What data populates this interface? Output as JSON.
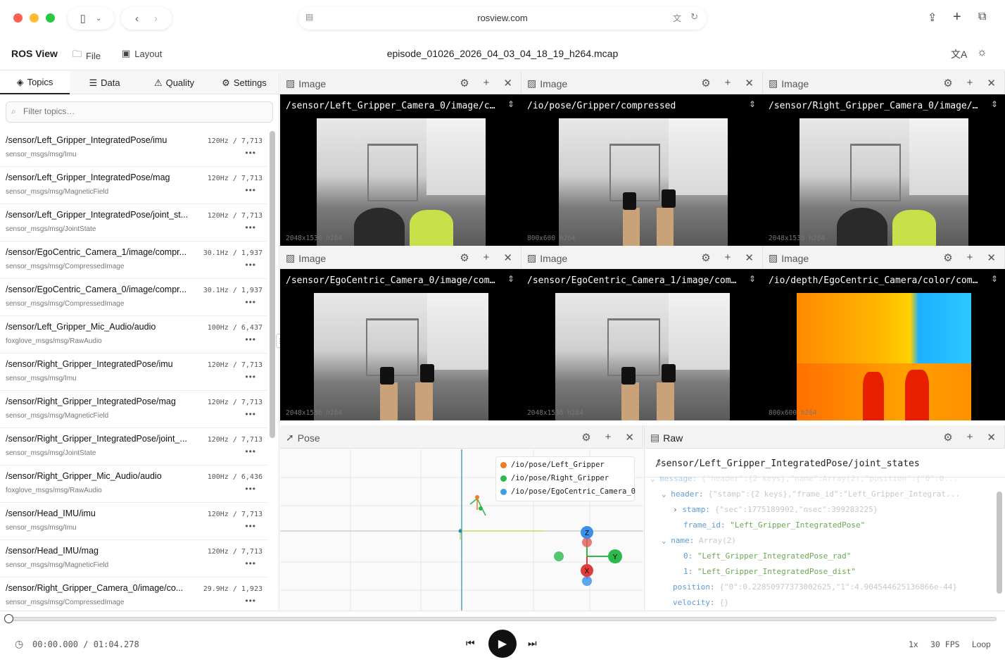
{
  "browser": {
    "url": "rosview.com"
  },
  "app": {
    "name": "ROS View",
    "menu_file": "File",
    "menu_layout": "Layout",
    "file_title": "episode_01026_2026_04_03_04_18_19_h264.mcap"
  },
  "sidebar": {
    "tabs": [
      "Topics",
      "Data",
      "Quality",
      "Settings"
    ],
    "filter_placeholder": "Filter topics…",
    "topics": [
      {
        "name": "/sensor/Left_Gripper_IntegratedPose/imu",
        "type": "sensor_msgs/msg/Imu",
        "rate": "120Hz / 7,713"
      },
      {
        "name": "/sensor/Left_Gripper_IntegratedPose/mag",
        "type": "sensor_msgs/msg/MagneticField",
        "rate": "120Hz / 7,713"
      },
      {
        "name": "/sensor/Left_Gripper_IntegratedPose/joint_st...",
        "type": "sensor_msgs/msg/JointState",
        "rate": "120Hz / 7,713"
      },
      {
        "name": "/sensor/EgoCentric_Camera_1/image/compr...",
        "type": "sensor_msgs/msg/CompressedImage",
        "rate": "30.1Hz / 1,937"
      },
      {
        "name": "/sensor/EgoCentric_Camera_0/image/compr...",
        "type": "sensor_msgs/msg/CompressedImage",
        "rate": "30.1Hz / 1,937"
      },
      {
        "name": "/sensor/Left_Gripper_Mic_Audio/audio",
        "type": "foxglove_msgs/msg/RawAudio",
        "rate": "100Hz / 6,437"
      },
      {
        "name": "/sensor/Right_Gripper_IntegratedPose/imu",
        "type": "sensor_msgs/msg/Imu",
        "rate": "120Hz / 7,713"
      },
      {
        "name": "/sensor/Right_Gripper_IntegratedPose/mag",
        "type": "sensor_msgs/msg/MagneticField",
        "rate": "120Hz / 7,713"
      },
      {
        "name": "/sensor/Right_Gripper_IntegratedPose/joint_...",
        "type": "sensor_msgs/msg/JointState",
        "rate": "120Hz / 7,713"
      },
      {
        "name": "/sensor/Right_Gripper_Mic_Audio/audio",
        "type": "foxglove_msgs/msg/RawAudio",
        "rate": "100Hz / 6,436"
      },
      {
        "name": "/sensor/Head_IMU/imu",
        "type": "sensor_msgs/msg/Imu",
        "rate": "120Hz / 7,713"
      },
      {
        "name": "/sensor/Head_IMU/mag",
        "type": "sensor_msgs/msg/MagneticField",
        "rate": "120Hz / 7,713"
      },
      {
        "name": "/sensor/Right_Gripper_Camera_0/image/co...",
        "type": "sensor_msgs/msg/CompressedImage",
        "rate": "29.9Hz / 1,923"
      }
    ]
  },
  "panels": {
    "image_title": "Image",
    "images": [
      {
        "topic": "/sensor/Left_Gripper_Camera_0/image/com...",
        "res": "2048x1536 h264"
      },
      {
        "topic": "/io/pose/Gripper/compressed",
        "res": "800x600 h264"
      },
      {
        "topic": "/sensor/Right_Gripper_Camera_0/image/co...",
        "res": "2048x1536 h264"
      },
      {
        "topic": "/sensor/EgoCentric_Camera_0/image/compr...",
        "res": "2048x1536 h264"
      },
      {
        "topic": "/sensor/EgoCentric_Camera_1/image/compr...",
        "res": "2048x1536 h264"
      },
      {
        "topic": "/io/depth/EgoCentric_Camera/color/compr...",
        "res": "800x600 h264"
      }
    ],
    "pose": {
      "title": "Pose",
      "legend": [
        "/io/pose/Left_Gripper",
        "/io/pose/Right_Gripper",
        "/io/pose/EgoCentric_Camera_0"
      ],
      "legend_colors": [
        "#f07a2a",
        "#2db84d",
        "#3aa0e0"
      ],
      "axis_labels": [
        "Z",
        "Y",
        "X"
      ]
    },
    "raw": {
      "title": "Raw",
      "topic": "/sensor/Left_Gripper_IntegratedPose/joint_states",
      "lines": {
        "message_key": "message:",
        "message_val": "{\"header\":{2 keys},\"name\":Array(2),\"position\":{\"0\":0...",
        "header_key": "header:",
        "header_val": "{\"stamp\":{2 keys},\"frame_id\":\"Left_Gripper_Integrat...",
        "stamp_key": "stamp:",
        "stamp_val": "{\"sec\":1775189902,\"nsec\":399283225}",
        "frame_id_key": "frame_id:",
        "frame_id_val": "\"Left_Gripper_IntegratedPose\"",
        "name_key": "name:",
        "name_val": "Array(2)",
        "name0_key": "0:",
        "name0_val": "\"Left_Gripper_IntegratedPose_rad\"",
        "name1_key": "1:",
        "name1_val": "\"Left_Gripper_IntegratedPose_dist\"",
        "position_key": "position:",
        "position_val": "{\"0\":0.22850977373002625,\"1\":4.904544625136866e-44}",
        "velocity_key": "velocity:",
        "velocity_val": "{}"
      }
    }
  },
  "playback": {
    "time": "00:00.000 / 01:04.278",
    "progress": 0.0,
    "speed": "1x",
    "fps": "30 FPS",
    "loop": "Loop"
  }
}
